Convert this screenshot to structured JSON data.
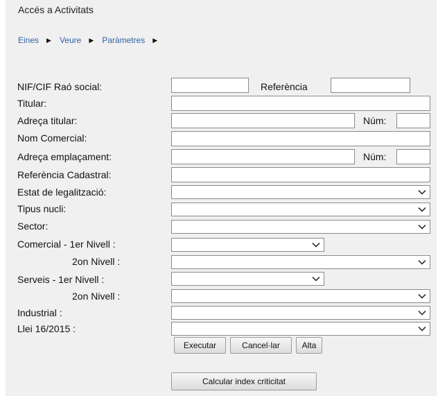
{
  "header": {
    "title": "Accés a Activitats"
  },
  "breadcrumb": [
    "Eines",
    "Veure",
    "Paràmetres"
  ],
  "form": {
    "nif_label": "NIF/CIF Raó social:",
    "referencia_label": "Referència",
    "titular_label": "Titular:",
    "adreca_titular_label": "Adreça titular:",
    "num_label_1": "Núm:",
    "nom_comercial_label": "Nom Comercial:",
    "adreca_empl_label": "Adreça emplaçament:",
    "num_label_2": "Núm:",
    "ref_cadastral_label": "Referència Cadastral:",
    "estat_label": "Estat de legalització:",
    "tipus_nucli_label": "Tipus nucli:",
    "sector_label": "Sector:",
    "comercial_1_label": "Comercial - 1er Nivell :",
    "comercial_2_label": "2on Nivell :",
    "serveis_1_label": "Serveis - 1er Nivell :",
    "serveis_2_label": "2on Nivell :",
    "industrial_label": "Industrial :",
    "llei_label": "Llei 16/2015 :"
  },
  "actions": {
    "executar": "Executar",
    "cancelar": "Cancel·lar",
    "alta": "Alta",
    "calcular": "Calcular index criticitat"
  },
  "colors": {
    "panel": "#f0f0f0",
    "link": "#2f64a8"
  },
  "icons": {
    "breadcrumb_separator": "triangle-right-icon",
    "select_arrow": "chevron-down-icon"
  }
}
